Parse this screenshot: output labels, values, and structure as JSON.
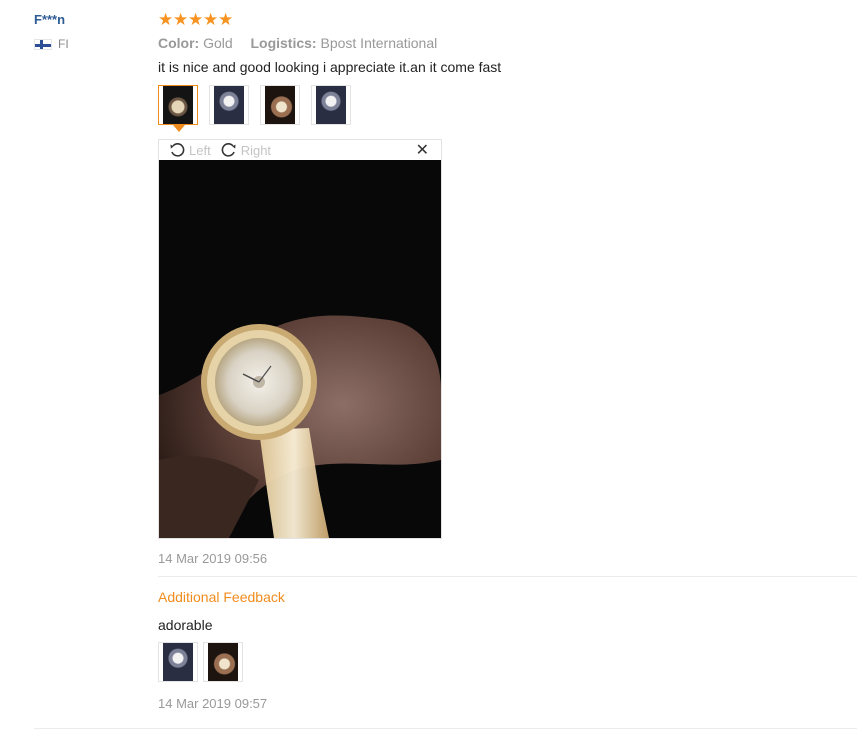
{
  "user": {
    "name": "F***n",
    "country": "FI"
  },
  "review": {
    "rating": 5,
    "color_label": "Color:",
    "color_value": "Gold",
    "logistics_label": "Logistics:",
    "logistics_value": "Bpost International",
    "text": "it is nice and good looking i appreciate it.an it come fast",
    "thumbnails": [
      "watch-photo-1",
      "watch-photo-2",
      "watch-photo-3",
      "watch-photo-4"
    ],
    "viewer": {
      "rotate_left": "Left",
      "rotate_right": "Right",
      "close": "✕"
    },
    "date": "14 Mar 2019 09:56"
  },
  "additional": {
    "title": "Additional Feedback",
    "text": "adorable",
    "thumbnails": [
      "watch-photo-5",
      "watch-photo-6"
    ],
    "date": "14 Mar 2019 09:57"
  },
  "colors": {
    "accent": "#f08c1e",
    "star": "#f79421",
    "username": "#2f5c94"
  }
}
